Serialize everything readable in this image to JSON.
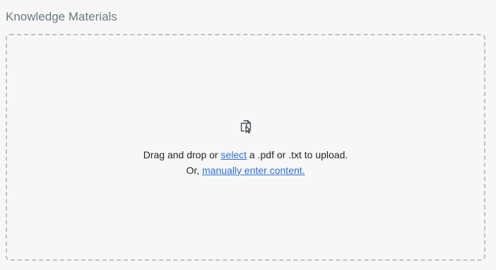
{
  "section": {
    "title": "Knowledge Materials"
  },
  "dropzone": {
    "icon": "files-drag-icon",
    "line1_prefix": "Drag and drop or ",
    "select_link": "select",
    "line1_suffix": " a .pdf or .txt to upload.",
    "line2_prefix": "Or, ",
    "manual_link": "manually enter content."
  },
  "colors": {
    "title": "#6a7a80",
    "border": "#b9c6c3",
    "link": "#2f6fd6",
    "text": "#1f2328",
    "background": "#f7f7f7"
  }
}
